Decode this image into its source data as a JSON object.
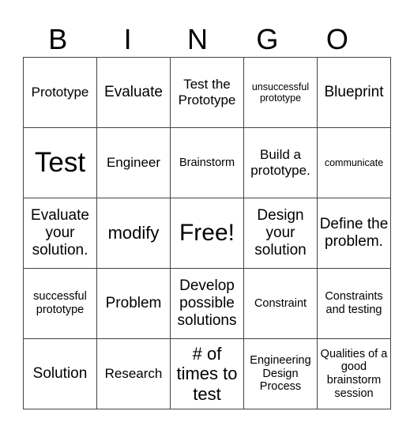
{
  "title_letters": [
    "B",
    "I",
    "N",
    "G",
    "O"
  ],
  "rows": [
    [
      {
        "text": "Prototype",
        "size": "md"
      },
      {
        "text": "Evaluate",
        "size": "lg"
      },
      {
        "text": "Test the Prototype",
        "size": "md"
      },
      {
        "text": "unsuccessful prototype",
        "size": "xs"
      },
      {
        "text": "Blueprint",
        "size": "lg"
      }
    ],
    [
      {
        "text": "Test",
        "size": "huge"
      },
      {
        "text": "Engineer",
        "size": "md"
      },
      {
        "text": "Brainstorm",
        "size": "sm"
      },
      {
        "text": "Build a prototype.",
        "size": "md"
      },
      {
        "text": "communicate",
        "size": "xs"
      }
    ],
    [
      {
        "text": "Evaluate your solution.",
        "size": "lg"
      },
      {
        "text": "modify",
        "size": "xl"
      },
      {
        "text": "Free!",
        "size": "xxl"
      },
      {
        "text": "Design your solution",
        "size": "lg"
      },
      {
        "text": "Define the problem.",
        "size": "lg"
      }
    ],
    [
      {
        "text": "successful prototype",
        "size": "sm"
      },
      {
        "text": "Problem",
        "size": "lg"
      },
      {
        "text": "Develop possible solutions",
        "size": "lg"
      },
      {
        "text": "Constraint",
        "size": "sm"
      },
      {
        "text": "Constraints and testing",
        "size": "sm"
      }
    ],
    [
      {
        "text": "Solution",
        "size": "lg"
      },
      {
        "text": "Research",
        "size": "md"
      },
      {
        "text": "# of times to test",
        "size": "xl"
      },
      {
        "text": "Engineering Design Process",
        "size": "sm"
      },
      {
        "text": "Qualities of a good brainstorm session",
        "size": "sm"
      }
    ]
  ]
}
